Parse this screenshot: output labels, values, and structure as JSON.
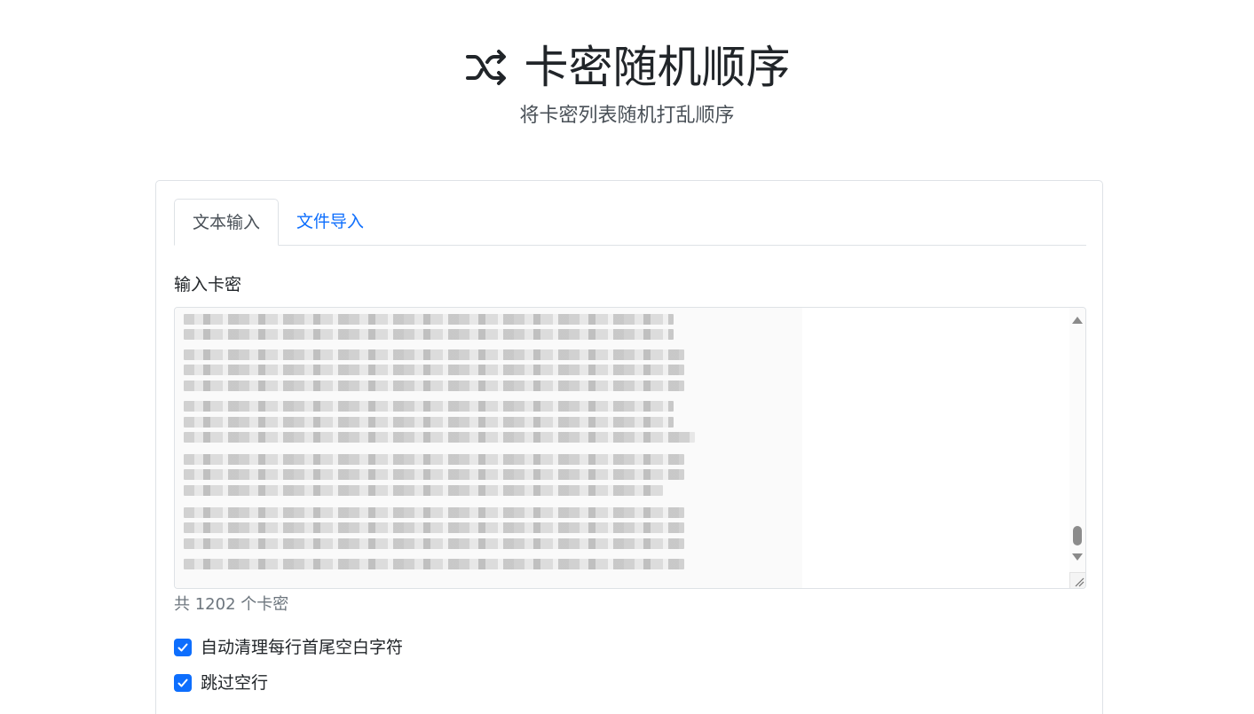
{
  "header": {
    "title": "卡密随机顺序",
    "subtitle": "将卡密列表随机打乱顺序",
    "icon": "shuffle-icon"
  },
  "tabs": [
    {
      "label": "文本输入",
      "active": true
    },
    {
      "label": "文件导入",
      "active": false
    }
  ],
  "input": {
    "label": "输入卡密",
    "content_state": "blurred"
  },
  "count_text": "共 1202 个卡密",
  "options": [
    {
      "label": "自动清理每行首尾空白字符",
      "checked": true
    },
    {
      "label": "跳过空行",
      "checked": true
    }
  ],
  "colors": {
    "accent": "#0d6efd",
    "text": "#212529",
    "muted": "#6c757d",
    "border": "#dee2e6"
  }
}
